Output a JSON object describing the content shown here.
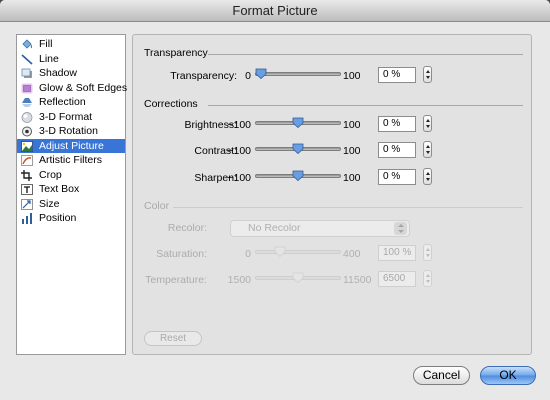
{
  "window": {
    "title": "Format Picture"
  },
  "sidebar": {
    "items": [
      {
        "label": "Fill",
        "icon": "paint-bucket-icon"
      },
      {
        "label": "Line",
        "icon": "line-icon"
      },
      {
        "label": "Shadow",
        "icon": "shadow-icon"
      },
      {
        "label": "Glow & Soft Edges",
        "icon": "glow-icon"
      },
      {
        "label": "Reflection",
        "icon": "reflection-icon"
      },
      {
        "label": "3-D Format",
        "icon": "3d-format-icon"
      },
      {
        "label": "3-D Rotation",
        "icon": "3d-rotation-icon"
      },
      {
        "label": "Adjust Picture",
        "icon": "adjust-picture-icon",
        "selected": true
      },
      {
        "label": "Artistic Filters",
        "icon": "artistic-filters-icon"
      },
      {
        "label": "Crop",
        "icon": "crop-icon"
      },
      {
        "label": "Text Box",
        "icon": "text-box-icon"
      },
      {
        "label": "Size",
        "icon": "size-icon"
      },
      {
        "label": "Position",
        "icon": "position-icon"
      }
    ]
  },
  "transparency": {
    "section_title": "Transparency",
    "row": {
      "label": "Transparency:",
      "min": "0",
      "max": "100",
      "value": "0 %",
      "level": 0.0
    }
  },
  "corrections": {
    "section_title": "Corrections",
    "rows": [
      {
        "label": "Brightness:",
        "min": "−100",
        "max": "100",
        "value": "0 %",
        "level": 0.5
      },
      {
        "label": "Contrast:",
        "min": "−100",
        "max": "100",
        "value": "0 %",
        "level": 0.5
      },
      {
        "label": "Sharpen:",
        "min": "−100",
        "max": "100",
        "value": "0 %",
        "level": 0.5
      }
    ]
  },
  "color": {
    "section_title": "Color",
    "recolor": {
      "label": "Recolor:",
      "value": "No Recolor"
    },
    "rows": [
      {
        "label": "Saturation:",
        "min": "0",
        "max": "400",
        "value": "100 %",
        "level": 0.25
      },
      {
        "label": "Temperature:",
        "min": "1500",
        "max": "11500",
        "value": "6500",
        "level": 0.5
      }
    ]
  },
  "buttons": {
    "reset": "Reset",
    "cancel": "Cancel",
    "ok": "OK"
  },
  "colors": {
    "selection": "#3875d7",
    "ok_button": "#5b9ae6"
  }
}
